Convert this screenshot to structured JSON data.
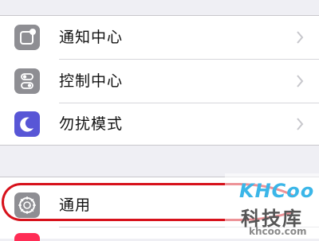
{
  "settings": {
    "group1": [
      {
        "label": "通知中心",
        "icon": "notification-center-icon",
        "color": "#8e8e93"
      },
      {
        "label": "控制中心",
        "icon": "control-center-icon",
        "color": "#8e8e93"
      },
      {
        "label": "勿扰模式",
        "icon": "moon-icon",
        "color": "#5856d6"
      }
    ],
    "group2": [
      {
        "label": "通用",
        "icon": "gear-icon",
        "color": "#8e8e93"
      }
    ]
  },
  "annotation": {
    "highlight_color": "#d7111b"
  },
  "watermark": {
    "logo": "KHCoo",
    "name": "科技库",
    "url": "khcoo.com"
  }
}
